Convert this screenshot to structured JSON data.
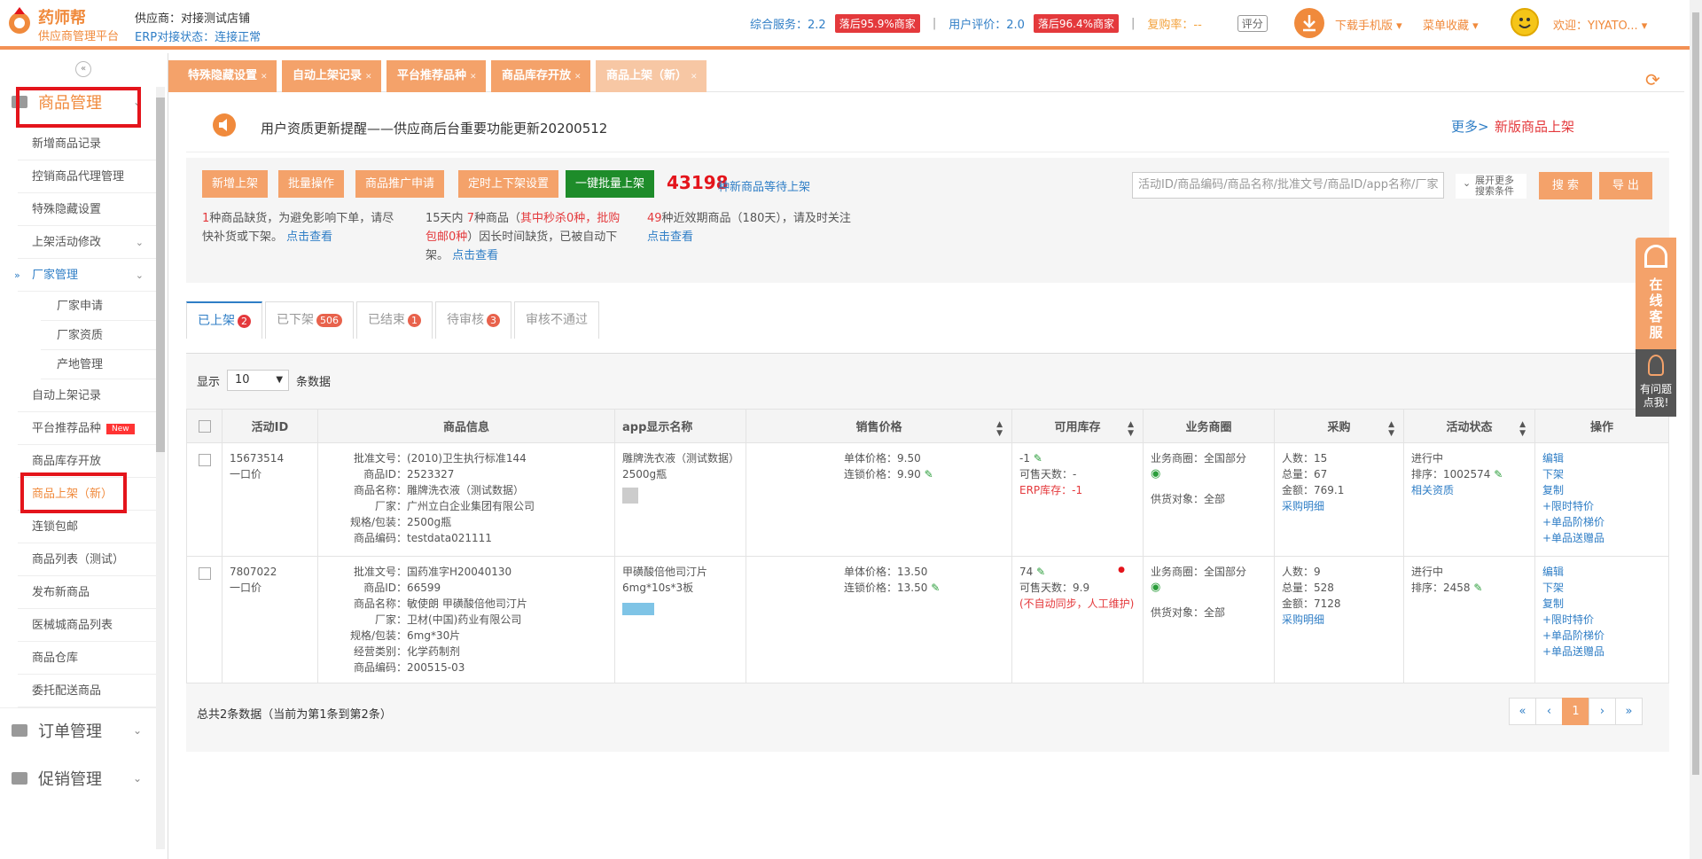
{
  "header": {
    "logo_title": "药师帮",
    "logo_sub": "供应商管理平台",
    "supplier": "供应商：对接测试店铺",
    "erp_label": "ERP对接状态：",
    "erp_status": "连接正常",
    "service_label": "综合服务：2.2",
    "service_badge": "落后95.9%商家",
    "rating_label": "用户评价：2.0",
    "rating_badge": "落后96.4%商家",
    "repurchase_label": "复购率：--",
    "score_btn": "评分",
    "download": "下载手机版 ▾",
    "favorites": "菜单收藏 ▾",
    "welcome": "欢迎：YIYATO... ▾"
  },
  "sidebar": {
    "collapse": "«",
    "group_goods": "商品管理",
    "items": [
      "新增商品记录",
      "控销商品代理管理",
      "特殊隐藏设置",
      "上架活动修改",
      "厂家管理",
      "厂家申请",
      "厂家资质",
      "产地管理",
      "自动上架记录",
      "平台推荐品种",
      "商品库存开放",
      "商品上架（新）",
      "连锁包邮",
      "商品列表（测试）",
      "发布新商品",
      "医械城商品列表",
      "商品仓库",
      "委托配送商品"
    ],
    "new_tag": "New",
    "group_orders": "订单管理",
    "group_promo": "促销管理"
  },
  "tabs": [
    {
      "label": "特殊隐藏设置"
    },
    {
      "label": "自动上架记录"
    },
    {
      "label": "平台推荐品种"
    },
    {
      "label": "商品库存开放"
    },
    {
      "label": "商品上架（新）"
    }
  ],
  "notice": {
    "text": "用户资质更新提醒——供应商后台重要功能更新20200512",
    "more": "更多>",
    "new_link": "新版商品上架"
  },
  "toolbar": {
    "btn_new": "新增上架",
    "btn_batch": "批量操作",
    "btn_promo": "商品推广申请",
    "btn_timer": "定时上下架设置",
    "btn_one_click": "一键批量上架",
    "pending_count": "43198",
    "pending_suffix": "种新商品等待上架",
    "search_placeholder": "活动ID/商品编码/商品名称/批准文号/商品ID/app名称/厂家",
    "expand_line1": "展开更多",
    "expand_line2": "搜索条件",
    "btn_search": "搜 索",
    "btn_export": "导 出"
  },
  "alerts": {
    "a1_num": "1",
    "a1_text": "种商品缺货，为避免影响下单，请尽快补货或下架。",
    "a1_link": "点击查看",
    "a2_pre": "15天内 ",
    "a2_num": "7",
    "a2_mid": "种商品（",
    "a2_red": "其中秒杀0种，批购包邮0种",
    "a2_post": "）因长时间缺货，已被自动下架。",
    "a2_link": "点击查看",
    "a3_num": "49",
    "a3_text": "种近效期商品（180天），请及时关注",
    "a3_link": "点击查看"
  },
  "status_tabs": [
    {
      "label": "已上架",
      "count": "2"
    },
    {
      "label": "已下架",
      "count": "506"
    },
    {
      "label": "已结束",
      "count": "1"
    },
    {
      "label": "待审核",
      "count": "3"
    },
    {
      "label": "审核不通过",
      "count": ""
    }
  ],
  "table": {
    "show_label": "显示",
    "page_size": "10",
    "rows_label": "条数据",
    "columns": [
      "活动ID",
      "商品信息",
      "app显示名称",
      "销售价格",
      "可用库存",
      "业务商圈",
      "采购",
      "活动状态",
      "操作"
    ],
    "rows": [
      {
        "id": "15673514",
        "id_type": "一口价",
        "info": [
          {
            "k": "批准文号：",
            "v": "(2010)卫生执行标准144"
          },
          {
            "k": "商品ID：",
            "v": "2523327"
          },
          {
            "k": "商品名称：",
            "v": "雕牌洗衣液（测试数据）"
          },
          {
            "k": "厂家：",
            "v": "广州立白企业集团有限公司"
          },
          {
            "k": "规格/包装：",
            "v": "2500g瓶"
          },
          {
            "k": "商品编码：",
            "v": "testdata021111"
          }
        ],
        "app_name": "雕牌洗衣液（测试数据）2500g瓶",
        "unit_price": "单体价格：9.50",
        "chain_price": "连锁价格：9.90",
        "stock": "-1",
        "days": "可售天数：-",
        "erp_stock": "ERP库存：-1",
        "biz": "业务商圈：全国部分",
        "supply": "供货对象：全部",
        "buyers": "人数：15",
        "qty": "总量：67",
        "amount": "金额：769.1",
        "purchase_link": "采购明细",
        "state": "进行中",
        "rank": "排序：1002574",
        "cert_link": "相关资质",
        "ops": [
          "编辑",
          "下架",
          "复制",
          "+限时特价",
          "+单品阶梯价",
          "+单品送赠品"
        ]
      },
      {
        "id": "7807022",
        "id_type": "一口价",
        "info": [
          {
            "k": "批准文号：",
            "v": "国药准字H20040130"
          },
          {
            "k": "商品ID：",
            "v": "66599"
          },
          {
            "k": "商品名称：",
            "v": "敏使朗 甲磺酸倍他司汀片"
          },
          {
            "k": "厂家：",
            "v": "卫材(中国)药业有限公司"
          },
          {
            "k": "规格/包装：",
            "v": "6mg*30片"
          },
          {
            "k": "经营类别：",
            "v": "化学药制剂"
          },
          {
            "k": "商品编码：",
            "v": "200515-03"
          }
        ],
        "app_name": "甲磺酸倍他司汀片 6mg*10s*3板",
        "unit_price": "单体价格：13.50",
        "chain_price": "连锁价格：13.50",
        "stock": "74",
        "days": "可售天数：9.9",
        "erp_stock": "(不自动同步，人工维护)",
        "biz": "业务商圈：全国部分",
        "supply": "供货对象：全部",
        "buyers": "人数：9",
        "qty": "总量：528",
        "amount": "金额：7128",
        "purchase_link": "采购明细",
        "state": "进行中",
        "rank": "排序：2458",
        "cert_link": "",
        "ops": [
          "编辑",
          "下架",
          "复制",
          "+限时特价",
          "+单品阶梯价",
          "+单品送赠品"
        ]
      }
    ],
    "total": "总共2条数据（当前为第1条到第2条）",
    "pager": [
      "«",
      "‹",
      "1",
      "›",
      "»"
    ]
  },
  "widgets": {
    "kefu": "在线客服",
    "ask": "有问题点我!"
  }
}
